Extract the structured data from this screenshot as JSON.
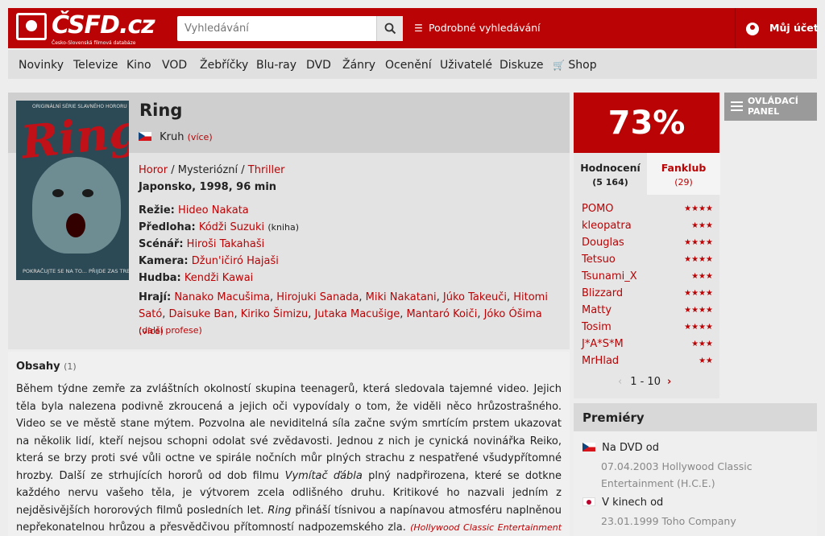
{
  "brand": {
    "logo_text": "ČSFD.cz",
    "logo_sub": "Česko-Slovenská filmová databáze",
    "accent": "#ba0305"
  },
  "search": {
    "placeholder": "Vyhledávání",
    "advanced_label": "Podrobné vyhledávání"
  },
  "account": {
    "label": "Můj účet"
  },
  "nav": [
    "Novinky",
    "Televize",
    "Kino",
    "VOD",
    "Žebříčky",
    "Blu-ray",
    "DVD",
    "Žánry",
    "Ocenění",
    "Uživatelé",
    "Diskuze",
    "Shop"
  ],
  "control_panel": {
    "line1": "OVLÁDACÍ",
    "line2": "PANEL"
  },
  "film": {
    "title": "Ring",
    "alt_title": "Kruh",
    "alt_more": "(více)",
    "genres": [
      "Horor",
      "Mysteriózní",
      "Thriller"
    ],
    "origin": "Japonsko, 1998, 96 min",
    "crew": [
      {
        "role": "Režie:",
        "name": "Hideo Nakata",
        "note": ""
      },
      {
        "role": "Předloha:",
        "name": "Kódži Suzuki",
        "note": "(kniha)"
      },
      {
        "role": "Scénář:",
        "name": "Hiroši Takahaši",
        "note": ""
      },
      {
        "role": "Kamera:",
        "name": "Džun'ičiró Hajaši",
        "note": ""
      },
      {
        "role": "Hudba:",
        "name": "Kendži Kawai",
        "note": ""
      }
    ],
    "cast_label": "Hrají:",
    "cast": [
      "Nanako Macušima",
      "Hirojuki Sanada",
      "Miki Nakatani",
      "Júko Takeuči",
      "Hitomi Sató",
      "Daisuke Ban",
      "Kiriko Šimizu",
      "Jutaka Macušige",
      "Mantaró Koiči",
      "Jóko Óšima"
    ],
    "cast_more": "(více)",
    "more_professions": "(další profese)",
    "poster": {
      "top_text": "ORIGINÁLNÍ SÉRIE SLAVNÉHO HORORU",
      "title": "Ring",
      "bottom_text": "POKRAČUJTE SE NA TO... PŘIJDE ZAS TREMOR"
    }
  },
  "plot": {
    "heading": "Obsahy",
    "count": "(1)",
    "p1": "Během týdne zemře za zvláštních okolností skupina teenagerů, která sledovala tajemné video. Jejich těla byla nalezena podivně zkroucená a jejich oči vypovídaly o tom, že viděli něco hrůzostrašného. Video se ve městě stane mýtem. Pozvolna ale neviditelná síla začne svým smrtícím prstem ukazovat na několik lidí, kteří nejsou schopni odolat své zvědavosti. Jednou z nich je cynická novinářka Reiko, která se brzy proti své vůli octne ve spirále nočních můr plných strachu z nespatřené všudypřítomné hrozby. Další ze strhujících hororů od dob filmu ",
    "film_ref": "Vymítač ďábla",
    "p2": " plný nadpřirozena, které se dotkne každého nervu vašeho těla, je výtvorem zcela odlišného druhu. Kritikové ho nazvali jedním z nejděsivějších hororových filmů posledních let. ",
    "ring_ref": "Ring",
    "p3": " přináší tísnivou a napínavou atmosféru naplněnou nepřekonatelnou hrůzou a přesvědčivou přítomností nadpozemského zla. ",
    "source": "(Hollywood Classic Entertainment (H.C.E.))"
  },
  "rating": {
    "percent": "73%",
    "tab_ratings": "Hodnocení",
    "tab_ratings_count": "(5 164)",
    "tab_fanclub": "Fanklub",
    "tab_fanclub_count": "(29)",
    "users": [
      {
        "name": "POMO",
        "stars": "★★★★"
      },
      {
        "name": "kleopatra",
        "stars": "★★★"
      },
      {
        "name": "Douglas",
        "stars": "★★★★"
      },
      {
        "name": "Tetsuo",
        "stars": "★★★★"
      },
      {
        "name": "Tsunami_X",
        "stars": "★★★"
      },
      {
        "name": "Blizzard",
        "stars": "★★★★"
      },
      {
        "name": "Matty",
        "stars": "★★★★"
      },
      {
        "name": "Tosim",
        "stars": "★★★★"
      },
      {
        "name": "J*A*S*M",
        "stars": "★★★"
      },
      {
        "name": "MrHlad",
        "stars": "★★"
      }
    ],
    "pager": "1 - 10"
  },
  "premieres": {
    "heading": "Premiéry",
    "items": [
      {
        "label": "Na DVD od",
        "line1": "07.04.2003 Hollywood Classic",
        "line2": "Entertainment (H.C.E.)"
      },
      {
        "label": "V kinech od",
        "line1": "23.01.1999 Toho Company",
        "line2": ""
      }
    ]
  }
}
